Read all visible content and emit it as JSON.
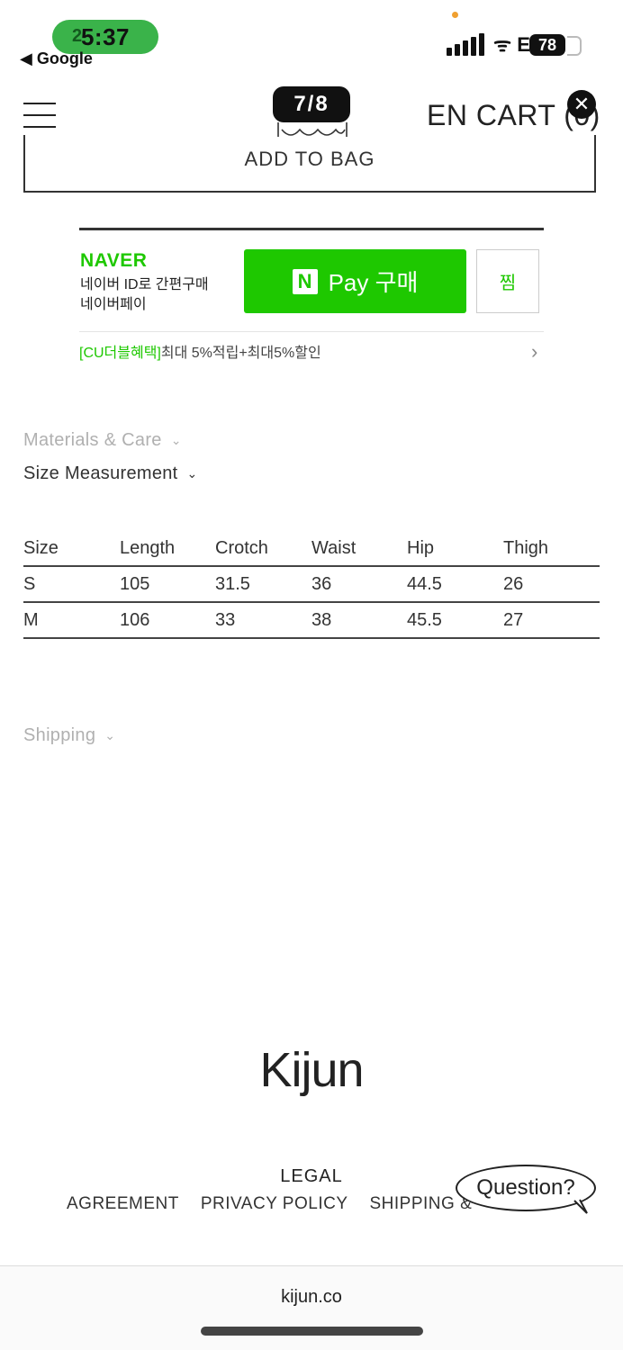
{
  "status_bar": {
    "time": "5:37",
    "time_underlay": "2",
    "back_label": "◀ Google",
    "wifi_glyph": "ᯤ E",
    "battery": "78"
  },
  "header": {
    "counter": "7/8",
    "lang_cart": "EN CART (0)",
    "close_glyph": "✕"
  },
  "product": {
    "add_to_bag": "ADD TO BAG"
  },
  "naver_pay": {
    "logo": "NAVER",
    "desc_line1": "네이버 ID로 간편구매",
    "desc_line2": "네이버페이",
    "pay_n": "N",
    "pay_label": "Pay 구매",
    "wish_label": "찜",
    "benefit_green": "[CU더블혜택]",
    "benefit_text": "최대 5%적립+최대5%할인",
    "brand_color": "#1ec800"
  },
  "accordions": {
    "materials": "Materials & Care",
    "size": "Size Measurement",
    "shipping": "Shipping",
    "chevron": "⌄"
  },
  "size_table": {
    "headers": [
      "Size",
      "Length",
      "Crotch",
      "Waist",
      "Hip",
      "Thigh"
    ],
    "rows": [
      [
        "S",
        "105",
        "31.5",
        "36",
        "44.5",
        "26"
      ],
      [
        "M",
        "106",
        "33",
        "38",
        "45.5",
        "27"
      ]
    ]
  },
  "footer": {
    "brand": "Kijun",
    "legal_title": "LEGAL",
    "links": [
      "AGREEMENT",
      "PRIVACY POLICY",
      "SHIPPING &"
    ],
    "question": "Question?"
  },
  "browser": {
    "url": "kijun.co"
  }
}
